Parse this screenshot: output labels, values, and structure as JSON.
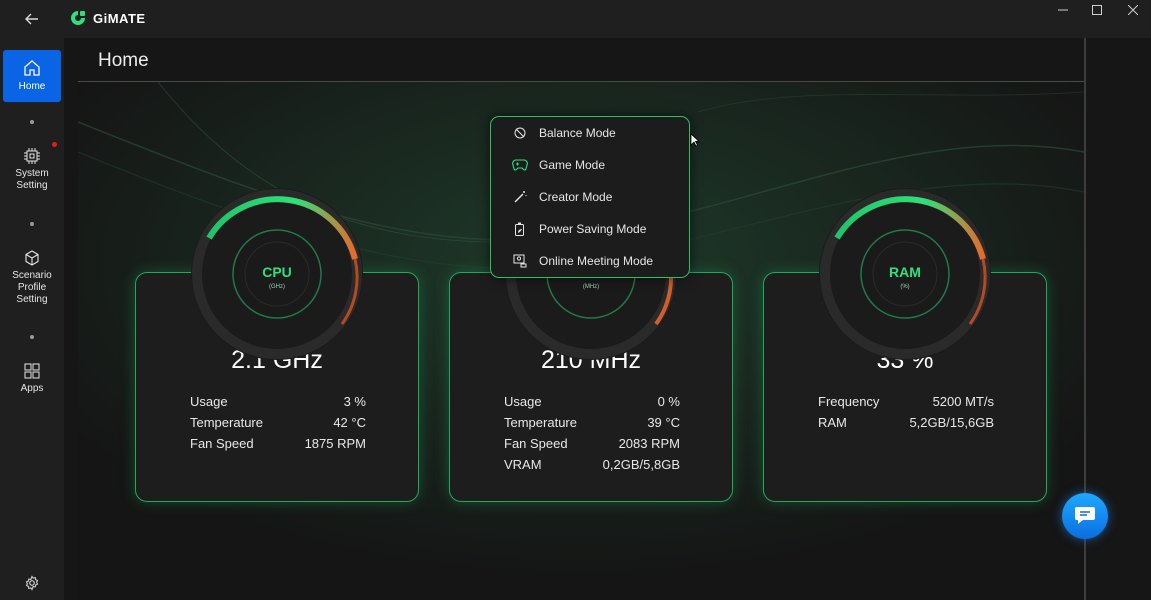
{
  "app": {
    "title": "GiMATE"
  },
  "sidebar": {
    "items": [
      {
        "label": "Home",
        "icon": "home-icon",
        "active": true
      },
      {
        "label": "System Setting",
        "icon": "chip-icon",
        "notification": true
      },
      {
        "label": "Scenario Profile Setting",
        "icon": "cube-icon"
      },
      {
        "label": "Apps",
        "icon": "apps-grid-icon"
      }
    ],
    "settings_icon": "gear-icon"
  },
  "page": {
    "title": "Home"
  },
  "cards": {
    "cpu": {
      "gauge_label": "CPU",
      "gauge_unit": "(GHz)",
      "value": "2.1 GHz",
      "stats": [
        {
          "label": "Usage",
          "value": "3 %"
        },
        {
          "label": "Temperature",
          "value": "42 °C"
        },
        {
          "label": "Fan Speed",
          "value": "1875 RPM"
        }
      ]
    },
    "gpu": {
      "gauge_unit": "(MHz)",
      "value": "210 MHz",
      "stats": [
        {
          "label": "Usage",
          "value": "0 %"
        },
        {
          "label": "Temperature",
          "value": "39 °C"
        },
        {
          "label": "Fan Speed",
          "value": "2083 RPM"
        },
        {
          "label": "VRAM",
          "value": "0,2GB/5,8GB"
        }
      ]
    },
    "ram": {
      "gauge_label": "RAM",
      "gauge_unit": "(%)",
      "value": "33 %",
      "stats": [
        {
          "label": "Frequency",
          "value": "5200 MT/s"
        },
        {
          "label": "RAM",
          "value": "5,2GB/15,6GB"
        }
      ]
    }
  },
  "mode_menu": {
    "items": [
      {
        "label": "Balance Mode",
        "icon": "balance-icon"
      },
      {
        "label": "Game Mode",
        "icon": "gamepad-icon"
      },
      {
        "label": "Creator Mode",
        "icon": "magic-wand-icon"
      },
      {
        "label": "Power Saving Mode",
        "icon": "battery-leaf-icon"
      },
      {
        "label": "Online Meeting Mode",
        "icon": "meeting-icon"
      }
    ]
  },
  "colors": {
    "accent_green": "#2ee07a",
    "active_blue": "#0a64e6",
    "chat_blue": "#1e8cff"
  }
}
